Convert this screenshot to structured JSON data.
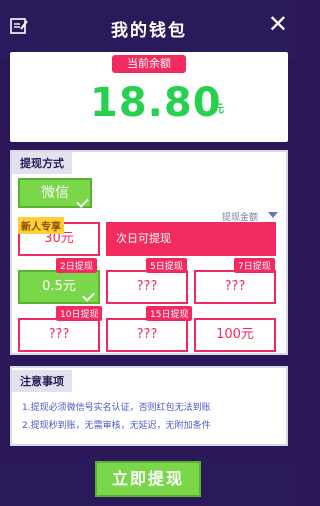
{
  "header": {
    "title": "我的钱包",
    "close_symbol": "✕"
  },
  "balance": {
    "tag": "当前余额",
    "amount": "18.80",
    "unit": "元"
  },
  "withdraw": {
    "method_title": "提现方式",
    "method_label": "微信",
    "all_link": "提现金额",
    "new_user_badge": "新人专享",
    "new_user_amount": "30元",
    "new_user_note": "次日可提现",
    "options": [
      {
        "tag": "2日提现",
        "amount": "0.5元",
        "selected": true
      },
      {
        "tag": "5日提现",
        "amount": "???"
      },
      {
        "tag": "7日提现",
        "amount": "???"
      },
      {
        "tag": "10日提现",
        "amount": "???"
      },
      {
        "tag": "15日提现",
        "amount": "???"
      },
      {
        "amount": "100元"
      }
    ]
  },
  "notes": {
    "title": "注意事项",
    "items": [
      "1.提现必须微信号实名认证，否则红包无法到账",
      "2.提现秒到账，无需审核，无延迟，无附加条件"
    ]
  },
  "bottom": {
    "button": "立即提现"
  },
  "colors": {
    "accent_green": "#7bd74a",
    "accent_red": "#f12b5f",
    "bg_purple": "#2b1758"
  }
}
